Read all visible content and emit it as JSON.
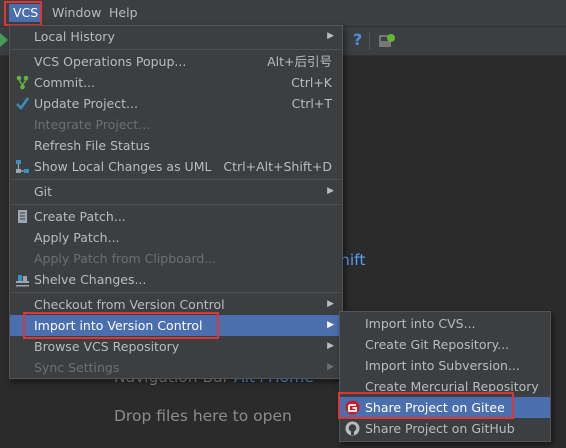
{
  "menubar": {
    "vcs": "VCS",
    "window": "Window",
    "help": "Help"
  },
  "toolbar": {
    "help_icon_glyph": "?"
  },
  "editor": {
    "partial_shortcut": "hift",
    "nav_label": "Navigation Bar",
    "nav_key": "Alt+Home",
    "drop_hint": "Drop files here to open"
  },
  "vcs_menu": {
    "local_history": "Local History",
    "vcs_operations": "VCS Operations Popup...",
    "vcs_operations_sc": "Alt+后引号",
    "commit": "Commit...",
    "commit_sc": "Ctrl+K",
    "update_project": "Update Project...",
    "update_project_sc": "Ctrl+T",
    "integrate_project": "Integrate Project...",
    "refresh_status": "Refresh File Status",
    "show_local_changes": "Show Local Changes as UML",
    "show_local_changes_sc": "Ctrl+Alt+Shift+D",
    "git": "Git",
    "create_patch": "Create Patch...",
    "apply_patch": "Apply Patch...",
    "apply_patch_clipboard": "Apply Patch from Clipboard...",
    "shelve_changes": "Shelve Changes...",
    "checkout": "Checkout from Version Control",
    "import_vc": "Import into Version Control",
    "browse_repo": "Browse VCS Repository",
    "sync_settings": "Sync Settings"
  },
  "import_submenu": {
    "import_cvs": "Import into CVS...",
    "create_git": "Create Git Repository...",
    "import_svn": "Import into Subversion...",
    "create_hg": "Create Mercurial Repository",
    "share_gitee": "Share Project on Gitee",
    "share_github": "Share Project on GitHub"
  },
  "colors": {
    "selection": "#4b6eaf",
    "highlight_box": "#e03535",
    "menu_bg": "#3c3f41",
    "editor_bg": "#2b2b2b",
    "link_blue": "#589df6"
  }
}
